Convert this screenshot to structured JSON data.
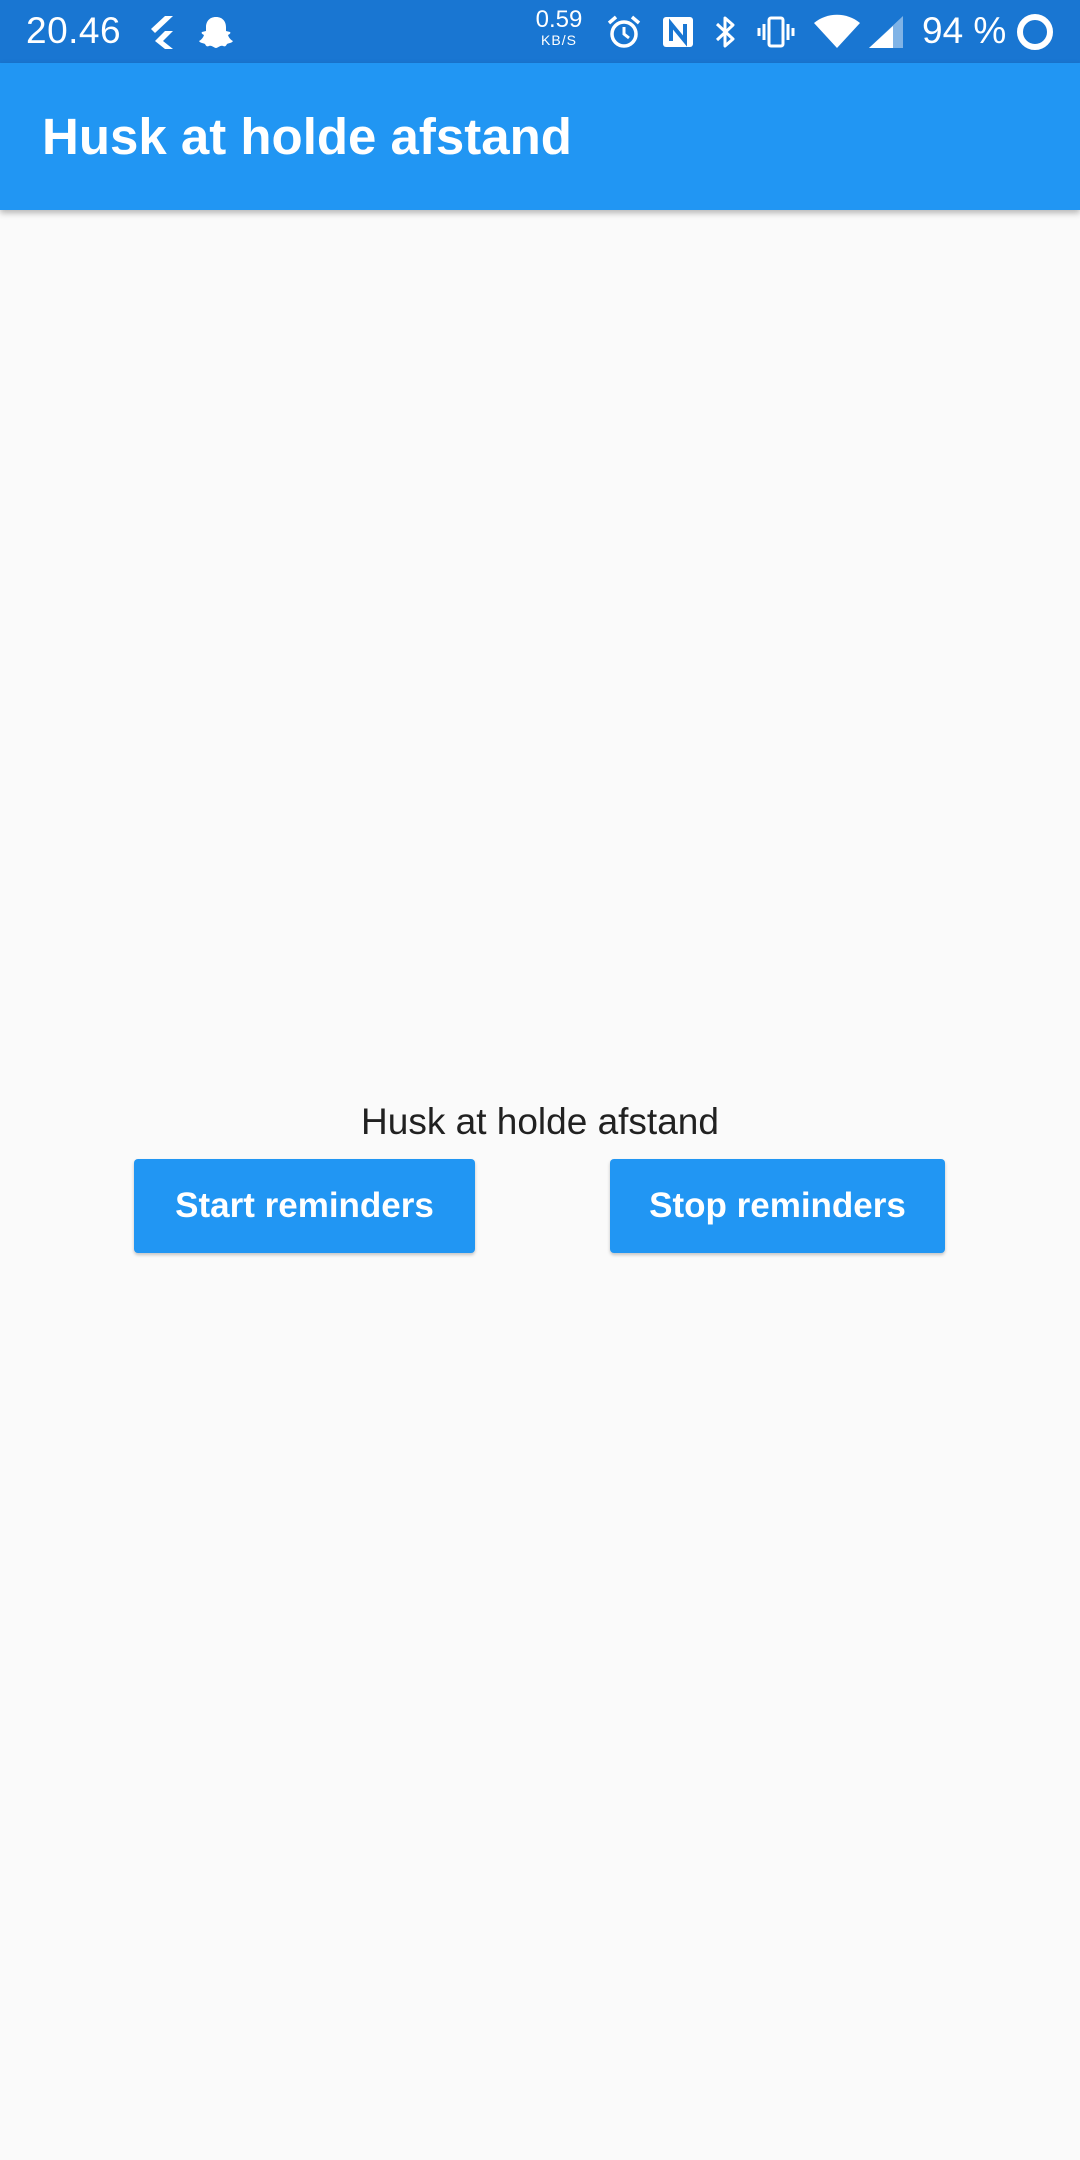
{
  "status_bar": {
    "time": "20.46",
    "net_speed_value": "0.59",
    "net_speed_unit": "KB/S",
    "battery_percent": "94 %",
    "icons": [
      "flutter-icon",
      "snapchat-icon",
      "alarm-icon",
      "nfc-icon",
      "bluetooth-icon",
      "vibrate-icon",
      "wifi-icon",
      "signal-icon",
      "battery-ring-icon"
    ],
    "color": "#1976d2"
  },
  "app_bar": {
    "title": "Husk at holde afstand",
    "color": "#2196f3"
  },
  "main": {
    "message": "Husk at holde afstand",
    "start_button_label": "Start reminders",
    "stop_button_label": "Stop reminders",
    "button_color": "#2196f3",
    "background": "#fafafa"
  }
}
